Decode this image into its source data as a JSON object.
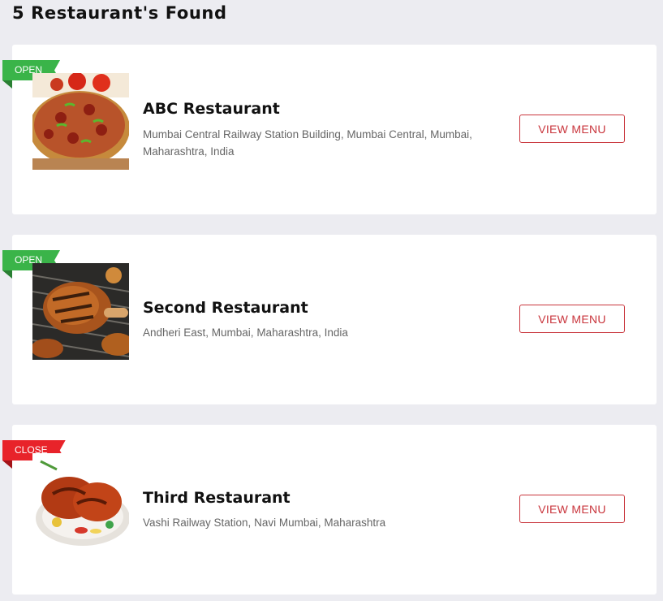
{
  "results": {
    "heading": "5 Restaurant's Found"
  },
  "restaurants": [
    {
      "status": "OPEN",
      "status_color": "#3ab449",
      "name": "ABC Restaurant",
      "address": "Mumbai Central Railway Station Building, Mumbai Central, Mumbai, Maharashtra, India",
      "button_label": "VIEW MENU",
      "image_icon": "pizza-image"
    },
    {
      "status": "OPEN",
      "status_color": "#3ab449",
      "name": "Second Restaurant",
      "address": "Andheri East, Mumbai, Maharashtra, India",
      "button_label": "VIEW MENU",
      "image_icon": "grilled-chicken-image"
    },
    {
      "status": "CLOSE",
      "status_color": "#e8232a",
      "name": "Third Restaurant",
      "address": "Vashi Railway Station, Navi Mumbai, Maharashtra",
      "button_label": "VIEW MENU",
      "image_icon": "tandoori-chicken-image"
    }
  ],
  "colors": {
    "accent": "#c9353c",
    "open": "#3ab449",
    "close": "#e8232a",
    "background": "#ececf1"
  }
}
